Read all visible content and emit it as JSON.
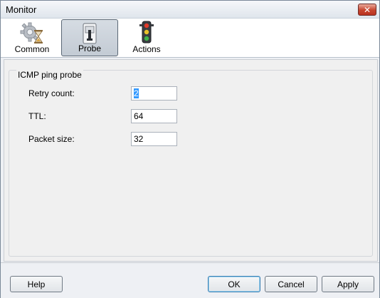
{
  "window": {
    "title": "Monitor"
  },
  "toolbar": {
    "items": [
      {
        "label": "Common",
        "icon": "gear-hourglass-icon",
        "selected": false
      },
      {
        "label": "Probe",
        "icon": "probe-device-icon",
        "selected": true
      },
      {
        "label": "Actions",
        "icon": "traffic-light-icon",
        "selected": false
      }
    ]
  },
  "group": {
    "title": "ICMP ping probe",
    "fields": [
      {
        "label": "Retry count:",
        "value": "2"
      },
      {
        "label": "TTL:",
        "value": "64"
      },
      {
        "label": "Packet size:",
        "value": "32"
      }
    ]
  },
  "buttons": {
    "help": "Help",
    "ok": "OK",
    "cancel": "Cancel",
    "apply": "Apply"
  },
  "colors": {
    "accent_selection": "#3399ff",
    "close_red": "#c7452f"
  }
}
